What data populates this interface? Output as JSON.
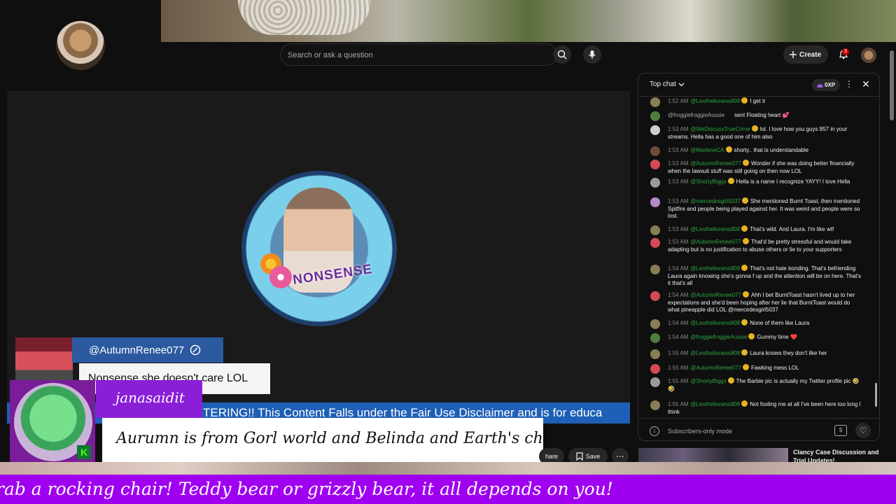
{
  "masthead": {
    "search_placeholder": "Search or ask a question",
    "create_label": "Create",
    "notification_count": "3"
  },
  "player": {
    "logo_text": "NONSENSE",
    "ticker_text": "TERING!! This Content Falls under the Fair Use Disclaimer and is for educa",
    "comment_card": {
      "handle": "@AutumnRenee077",
      "text": "Nonsense she doesn't care LOL"
    },
    "chat_overlay": {
      "username": "janasaidit",
      "message": "Aurumn is from Gorl world and Belinda and Earth's chats"
    }
  },
  "actions": {
    "share_label": "hare",
    "save_label": "Save"
  },
  "chat": {
    "title": "Top chat",
    "xp_label": "0XP",
    "footer_text": "Subscribers-only mode",
    "messages": [
      {
        "time": "1:52 AM",
        "author": "@Leothelioness808",
        "text": "I get it",
        "color": "#8a7d55"
      },
      {
        "time": "",
        "author": "@froggiefroggieAussie",
        "text": "sent Floating heart 💕",
        "color": "#4f7d3d"
      },
      {
        "time": "1:53 AM",
        "author": "@WeDiscussTrueCrime",
        "text": "lol. I love how you guys 857 in your streams. Hella has a good one of him also",
        "color": "#cfcfcf"
      },
      {
        "time": "1:53 AM",
        "author": "@MarleneCA",
        "text": "shorty.. that is understandable",
        "color": "#6b4b3a"
      },
      {
        "time": "1:53 AM",
        "author": "@AutumnRenee077",
        "text": "Wonder if she was doing better financially when the lawsuit stuff was still going on then now LOL",
        "color": "#d24a55"
      },
      {
        "time": "1:53 AM",
        "author": "@ShortyBiggs",
        "text": "Hella is a name I recognize YAYY! I love Hella",
        "color": "#9a9a9a"
      },
      {
        "time": "1:53 AM",
        "author": "@mercedesgirl5037",
        "text": "She mentioned Burnt Toast, then mentioned Spitfire and people being played against her. It was weird and people were so lost.",
        "color": "#b48ac9"
      },
      {
        "time": "1:53 AM",
        "author": "@Leothelioness808",
        "text": "That's wild. And Laura. I'm like wtf",
        "color": "#8a7d55"
      },
      {
        "time": "1:53 AM",
        "author": "@AutumnRenee077",
        "text": "That'd be pretty stressful and would take adapting but is no justification to abuse others or lie to your supporters",
        "color": "#d24a55"
      },
      {
        "time": "1:54 AM",
        "author": "@Leothelioness808",
        "text": "That's not hate bonding. That's befriending Laura again knowing she's gonna f up and the attention will be on here. That's it that's all",
        "color": "#8a7d55"
      },
      {
        "time": "1:54 AM",
        "author": "@AutumnRenee077",
        "text": "Ahh I bet BurntToast hasn't lived up to her expectations and she'd been hoping after her lie that BurntToast would do what pineapple did LOL @mercedesgirl5037",
        "color": "#d24a55"
      },
      {
        "time": "1:54 AM",
        "author": "@Leothelioness808",
        "text": "None of them like Laura",
        "color": "#8a7d55"
      },
      {
        "time": "1:54 AM",
        "author": "@froggiefroggieAussie",
        "text": "Gummy time ❤️",
        "color": "#4f7d3d"
      },
      {
        "time": "1:55 AM",
        "author": "@Leothelioness808",
        "text": "Laura knows they don't like her",
        "color": "#8a7d55"
      },
      {
        "time": "1:55 AM",
        "author": "@AutumnRenee077",
        "text": "Fawking mess LOL",
        "color": "#d24a55"
      },
      {
        "time": "1:55 AM",
        "author": "@ShortyBiggs",
        "text": "The Barbie pic is actually my Twitter profile pic 🤣🤣",
        "color": "#9a9a9a"
      },
      {
        "time": "1:55 AM",
        "author": "@Leothelioness808",
        "text": "Not fooling me at all I've been here too long I think",
        "color": "#8a7d55"
      }
    ]
  },
  "related": {
    "title": "Clancy Case Discussion and Trial Updates!"
  },
  "marquee": {
    "text": "rab a rocking chair! Teddy bear or grizzly bear, it all depends on you!"
  },
  "colors": {
    "accent_purple": "#a000f0",
    "chat_author_green": "#2ba640",
    "ticker_blue": "#1e5fb7"
  }
}
